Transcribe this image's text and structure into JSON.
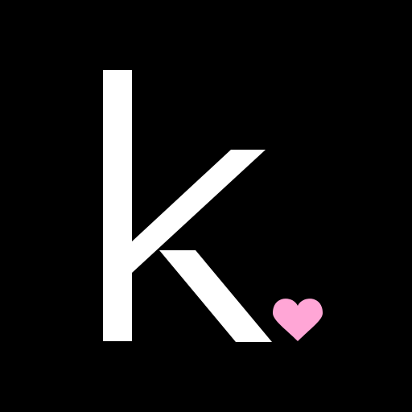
{
  "logo": {
    "letter": "k",
    "mark": "heart-icon"
  },
  "colors": {
    "background": "#000000",
    "letter": "#ffffff",
    "heart": "#ffa6d6"
  }
}
